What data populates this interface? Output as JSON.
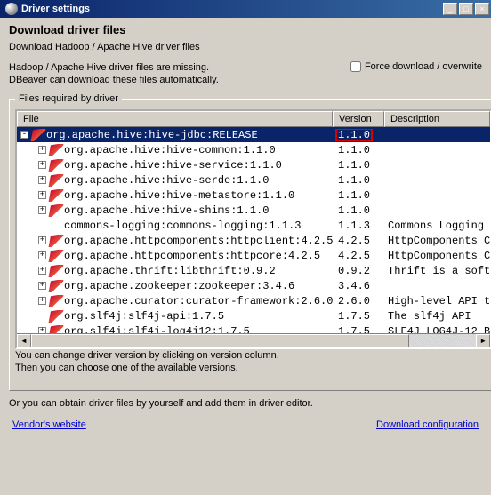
{
  "window": {
    "title": "Driver settings",
    "min": "_",
    "max": "□",
    "close": "×"
  },
  "header": {
    "title": "Download driver files",
    "subtitle": "Download Hadoop / Apache Hive driver files"
  },
  "missing": {
    "line1": "Hadoop / Apache Hive driver files are missing.",
    "line2": "DBeaver can download these files automatically."
  },
  "force_label": "Force download / overwrite",
  "fieldset_legend": "Files required by driver",
  "columns": {
    "file": "File",
    "version": "Version",
    "desc": "Description"
  },
  "rows": [
    {
      "indent": 0,
      "exp": "-",
      "icon": true,
      "file": "org.apache.hive:hive-jdbc:RELEASE",
      "ver": "1.1.0",
      "desc": "",
      "sel": true
    },
    {
      "indent": 1,
      "exp": "+",
      "icon": true,
      "file": "org.apache.hive:hive-common:1.1.0",
      "ver": "1.1.0",
      "desc": ""
    },
    {
      "indent": 1,
      "exp": "+",
      "icon": true,
      "file": "org.apache.hive:hive-service:1.1.0",
      "ver": "1.1.0",
      "desc": ""
    },
    {
      "indent": 1,
      "exp": "+",
      "icon": true,
      "file": "org.apache.hive:hive-serde:1.1.0",
      "ver": "1.1.0",
      "desc": ""
    },
    {
      "indent": 1,
      "exp": "+",
      "icon": true,
      "file": "org.apache.hive:hive-metastore:1.1.0",
      "ver": "1.1.0",
      "desc": ""
    },
    {
      "indent": 1,
      "exp": "+",
      "icon": true,
      "file": "org.apache.hive:hive-shims:1.1.0",
      "ver": "1.1.0",
      "desc": ""
    },
    {
      "indent": 1,
      "exp": "",
      "icon": false,
      "file": "commons-logging:commons-logging:1.1.3",
      "ver": "1.1.3",
      "desc": "Commons Logging"
    },
    {
      "indent": 1,
      "exp": "+",
      "icon": true,
      "file": "org.apache.httpcomponents:httpclient:4.2.5",
      "ver": "4.2.5",
      "desc": "HttpComponents C"
    },
    {
      "indent": 1,
      "exp": "+",
      "icon": true,
      "file": "org.apache.httpcomponents:httpcore:4.2.5",
      "ver": "4.2.5",
      "desc": "HttpComponents C"
    },
    {
      "indent": 1,
      "exp": "+",
      "icon": true,
      "file": "org.apache.thrift:libthrift:0.9.2",
      "ver": "0.9.2",
      "desc": "Thrift is a soft"
    },
    {
      "indent": 1,
      "exp": "+",
      "icon": true,
      "file": "org.apache.zookeeper:zookeeper:3.4.6",
      "ver": "3.4.6",
      "desc": ""
    },
    {
      "indent": 1,
      "exp": "+",
      "icon": true,
      "file": "org.apache.curator:curator-framework:2.6.0",
      "ver": "2.6.0",
      "desc": "High-level API t"
    },
    {
      "indent": 1,
      "exp": "",
      "icon": true,
      "file": "org.slf4j:slf4j-api:1.7.5",
      "ver": "1.7.5",
      "desc": "The slf4j API"
    },
    {
      "indent": 1,
      "exp": "+",
      "icon": true,
      "file": "org.slf4j:slf4j-log4j12:1.7.5",
      "ver": "1.7.5",
      "desc": "SLF4J LOG4J-12 B"
    }
  ],
  "hint": {
    "line1": "You can change driver version by clicking on version column.",
    "line2": "Then you can choose one of the available versions."
  },
  "obtain": "Or you can obtain driver files by yourself and add them in driver editor.",
  "links": {
    "vendor": "Vendor's website",
    "config": "Download configuration"
  }
}
